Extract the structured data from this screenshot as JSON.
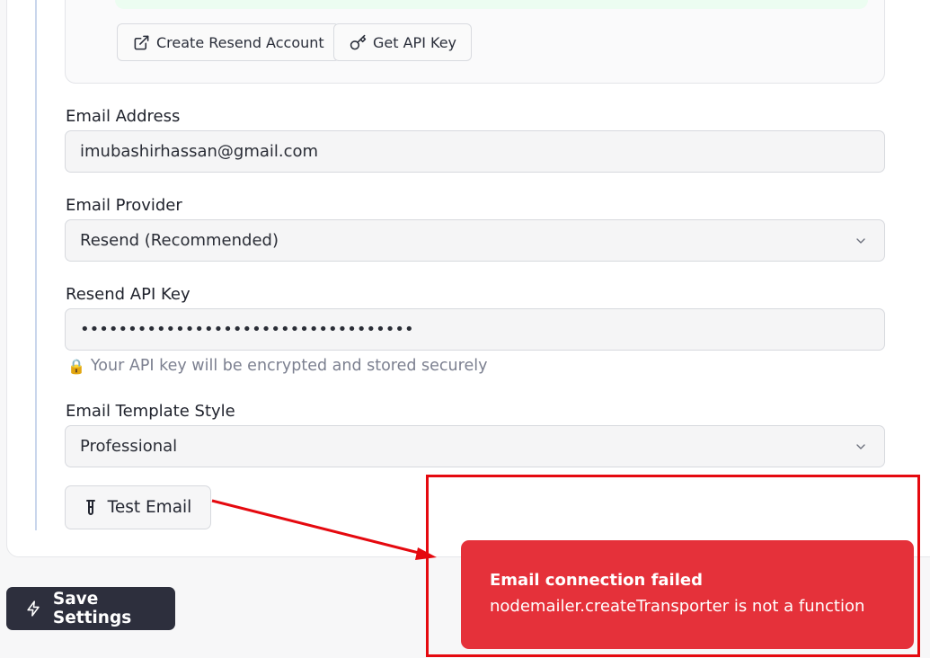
{
  "info_box": {
    "create_account_label": "Create Resend Account",
    "get_key_label": "Get API Key"
  },
  "form": {
    "email_address": {
      "label": "Email Address",
      "value": "imubashirhassan@gmail.com"
    },
    "email_provider": {
      "label": "Email Provider",
      "selected": "Resend (Recommended)"
    },
    "api_key": {
      "label": "Resend API Key",
      "masked_value": "•••••••••••••••••••••••••••••••••••",
      "hint": "Your API key will be encrypted and stored securely",
      "hint_icon": "🔒"
    },
    "template_style": {
      "label": "Email Template Style",
      "selected": "Professional"
    },
    "test_button_label": "Test Email"
  },
  "save_button_label": "Save Settings",
  "toast": {
    "title": "Email connection failed",
    "message": "nodemailer.createTransporter is not a function",
    "color": "#e5313a"
  },
  "annotation": {
    "color": "#e5090f"
  }
}
